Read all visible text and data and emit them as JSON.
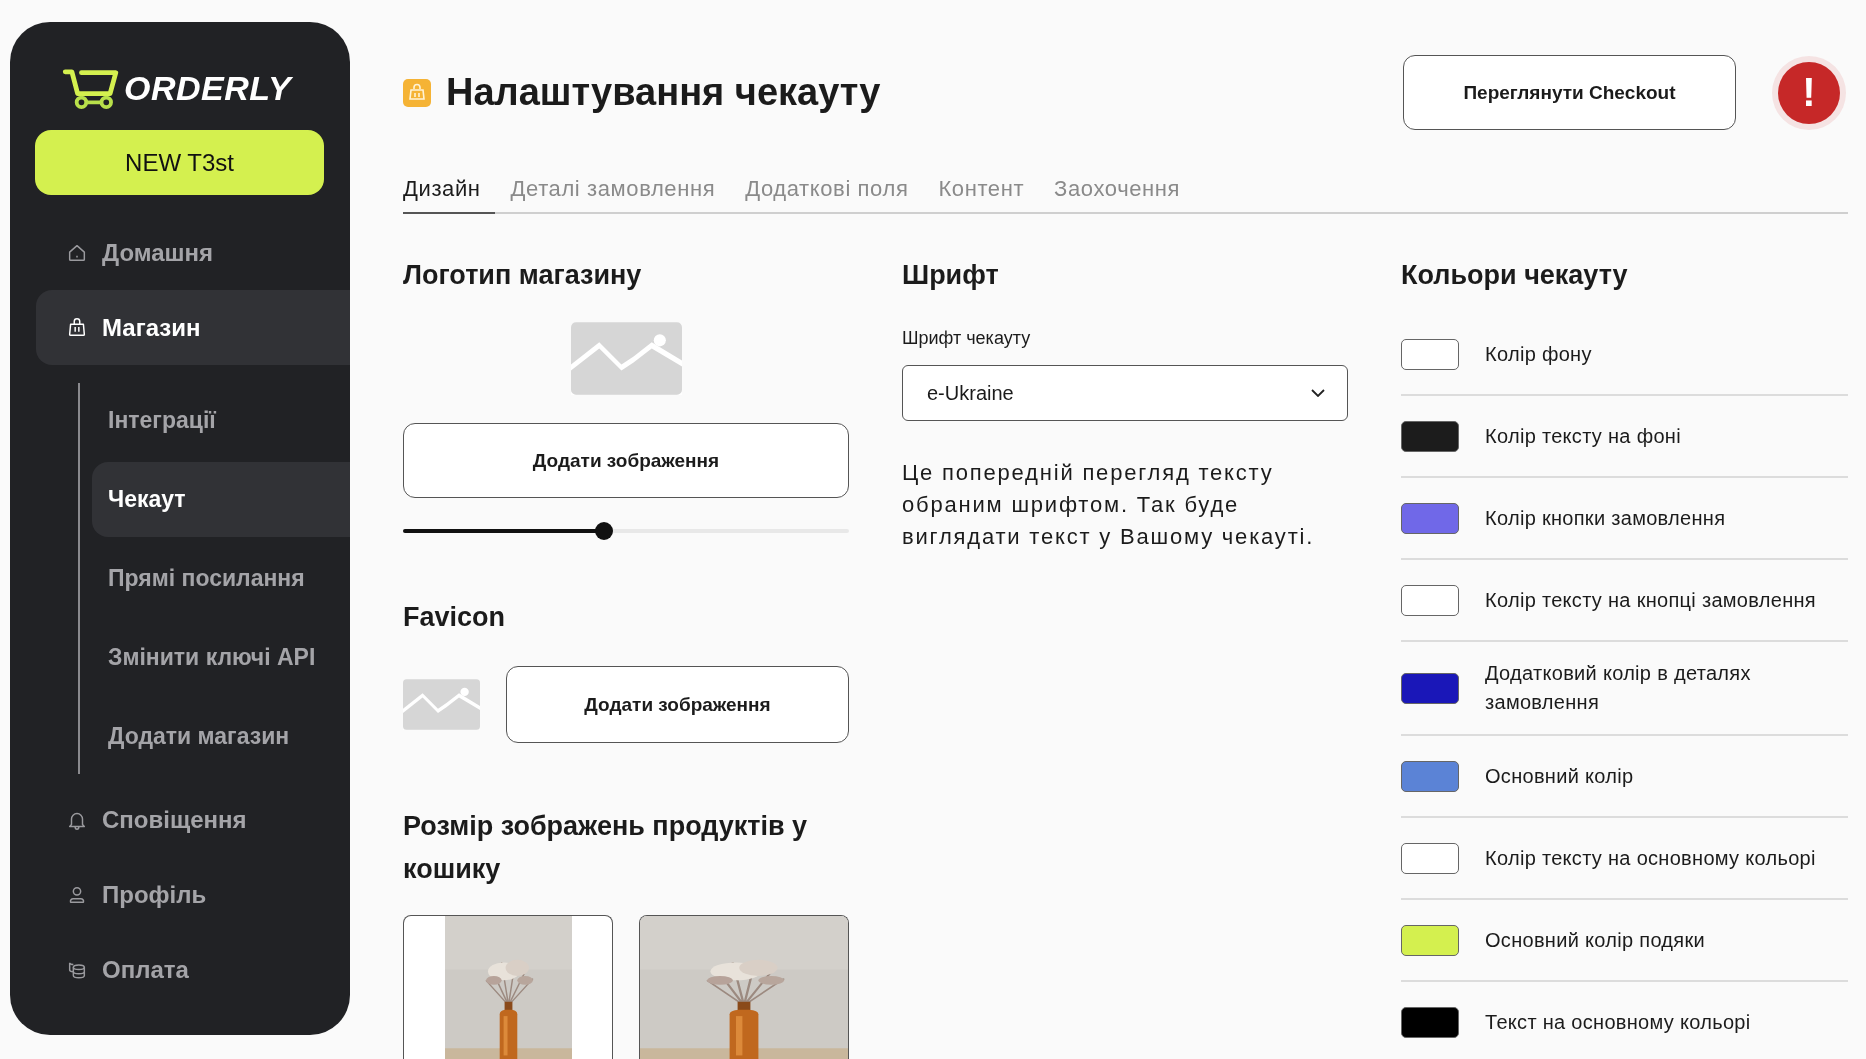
{
  "sidebar": {
    "logo": "ORDERLY",
    "store_button": "NEW T3st",
    "items": [
      {
        "label": "Домашня",
        "selected": false
      },
      {
        "label": "Магазин",
        "selected": true,
        "children": [
          {
            "label": "Інтеграції",
            "selected": false
          },
          {
            "label": "Чекаут",
            "selected": true
          },
          {
            "label": "Прямі посилання",
            "selected": false
          },
          {
            "label": "Змінити ключі API",
            "selected": false
          },
          {
            "label": "Додати магазин",
            "selected": false
          }
        ]
      },
      {
        "label": "Сповіщення",
        "selected": false
      },
      {
        "label": "Профіль",
        "selected": false
      },
      {
        "label": "Оплата",
        "selected": false
      }
    ]
  },
  "header": {
    "title": "Налаштування чекауту",
    "preview_button": "Переглянути Checkout",
    "alert_badge": "!"
  },
  "tabs": [
    {
      "label": "Дизайн",
      "selected": true
    },
    {
      "label": "Деталі замовлення",
      "selected": false
    },
    {
      "label": "Додаткові поля",
      "selected": false
    },
    {
      "label": "Контент",
      "selected": false
    },
    {
      "label": "Заохочення",
      "selected": false
    }
  ],
  "logo_section": {
    "heading": "Логотип магазину",
    "button": "Додати зображення",
    "size_slider": {
      "level": 0.45
    }
  },
  "favicon_section": {
    "heading": "Favicon",
    "button": "Додати зображення"
  },
  "product_image_section": {
    "heading": "Розмір зображень продуктів у кошику"
  },
  "font_section": {
    "heading": "Шрифт",
    "field_label": "Шрифт чекауту",
    "value": "e-Ukraine",
    "preview": "Це попередній перегляд тексту обраним шрифтом. Так буде виглядати текст у Вашому чекауті."
  },
  "colors_section": {
    "heading": "Кольори чекауту",
    "items": [
      {
        "label": "Колір фону",
        "color": "#ffffff"
      },
      {
        "label": "Колір тексту на фоні",
        "color": "#1c1c1c"
      },
      {
        "label": "Колір кнопки замовлення",
        "color": "#7068e8"
      },
      {
        "label": "Колір тексту на кнопці замовлення",
        "color": "#ffffff"
      },
      {
        "label": "Додатковий колір в деталях замовлення",
        "color": "#1a17b8"
      },
      {
        "label": "Основний колір",
        "color": "#5b83d6"
      },
      {
        "label": "Колір тексту на основному кольорі",
        "color": "#ffffff"
      },
      {
        "label": "Основний колір подяки",
        "color": "#d4f04f"
      },
      {
        "label": "Текст на основному кольорі",
        "color": "#000000"
      }
    ]
  }
}
